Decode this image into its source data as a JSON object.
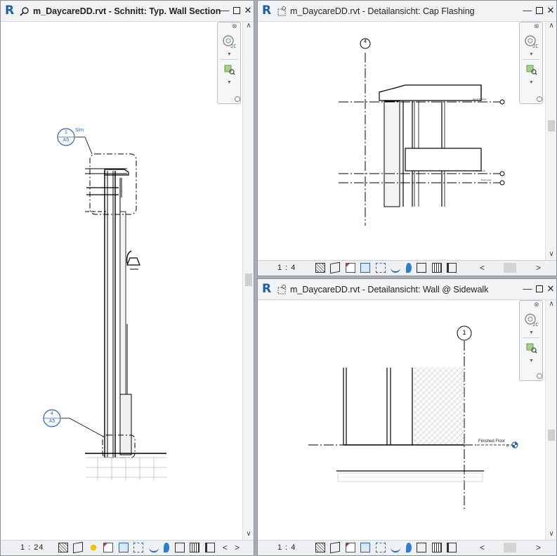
{
  "windows": {
    "wall_section": {
      "title": "m_DaycareDD.rvt - Schnitt: Typ. Wall Section",
      "scale": "1 : 24",
      "callout_top": {
        "number": "1",
        "sheet": "A5",
        "note": "Sim"
      },
      "callout_bottom": {
        "number": "4",
        "sheet": "A5"
      }
    },
    "cap_flashing": {
      "title": "m_DaycareDD.rvt - Detailansicht: Cap Flashing",
      "scale": "1 : 4",
      "grid_label": "4",
      "level_labels": [
        "Top of Parapet",
        "Roof Deck",
        "Roof Level"
      ]
    },
    "wall_sidewalk": {
      "title": "m_DaycareDD.rvt - Detailansicht: Wall @ Sidewalk",
      "scale": "1 : 4",
      "grid_label": "1",
      "level_label": "Finished Floor",
      "level_value": "0"
    }
  },
  "icons": {
    "app": "revit-logo-icon",
    "section_view": "section-view-icon",
    "detail_view": "detail-view-icon",
    "minimize": "minimize-icon",
    "maximize": "maximize-icon",
    "close": "close-icon"
  },
  "colors": {
    "revit_blue": "#1b5ea9",
    "callout_blue": "#2b62b8",
    "linework": "#000000"
  }
}
